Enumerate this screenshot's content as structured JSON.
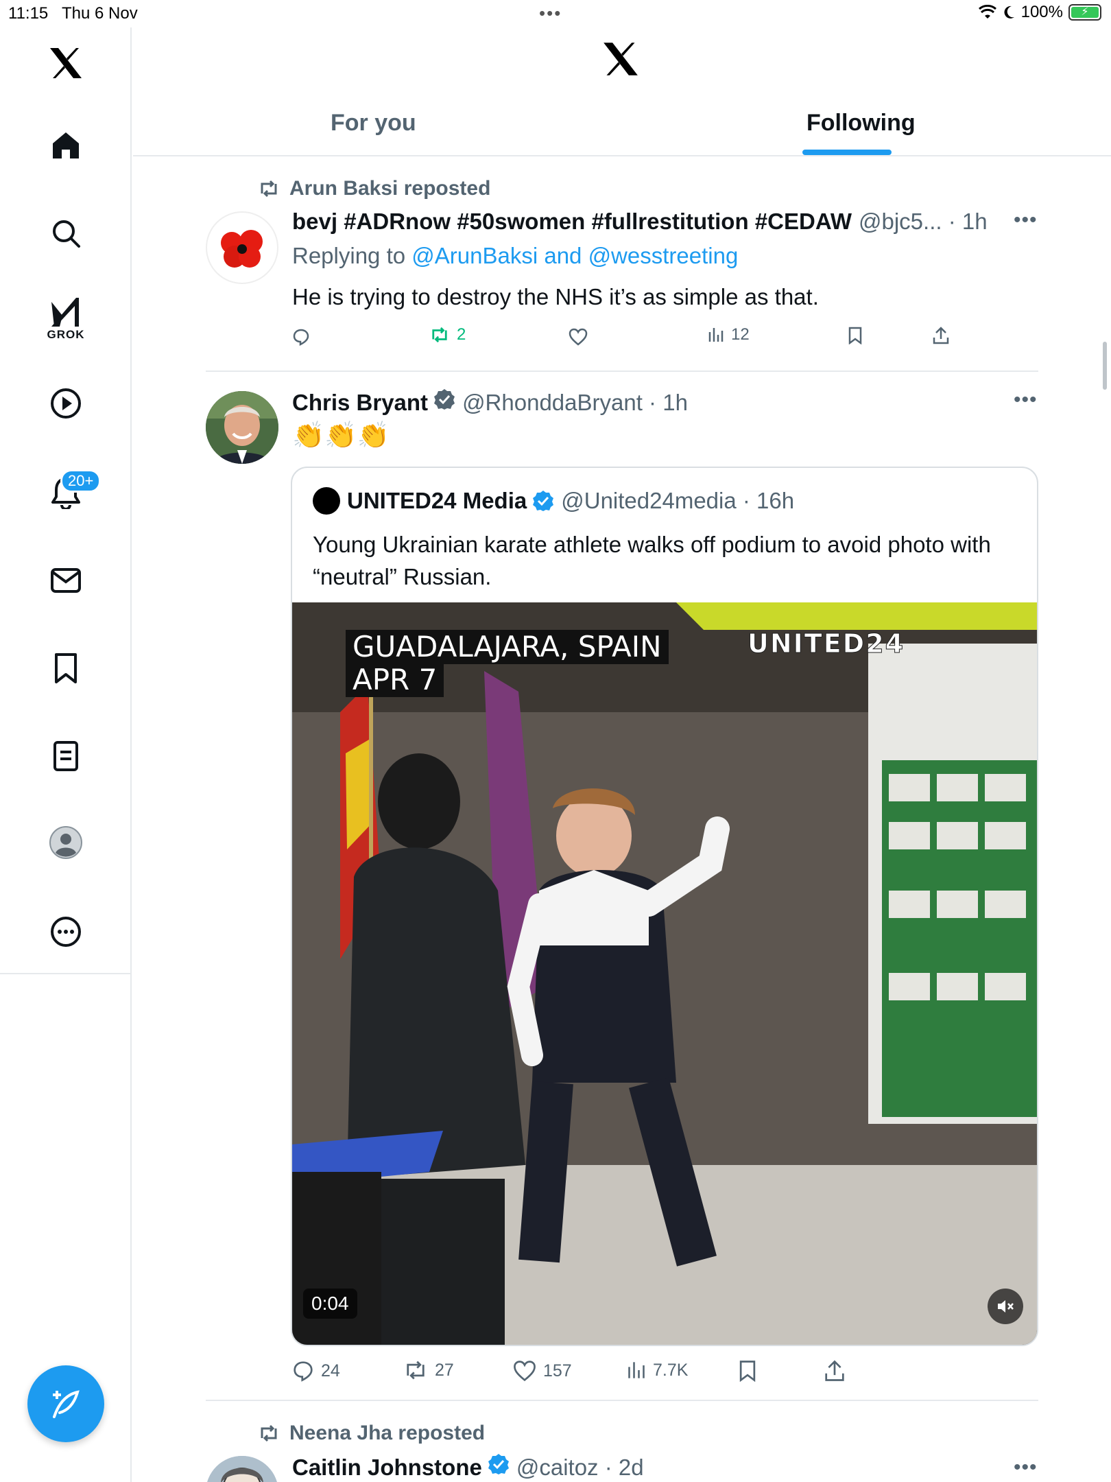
{
  "status": {
    "time": "11:15",
    "date": "Thu 6 Nov",
    "battery": "100%"
  },
  "sidebar": {
    "grok_label": "GROK",
    "notifications_badge": "20+"
  },
  "header": {
    "tabs": [
      {
        "label": "For you"
      },
      {
        "label": "Following"
      }
    ]
  },
  "tweets": [
    {
      "repost_by": "Arun Baksi reposted",
      "name": "bevj #ADRnow #50swomen #fullrestitution #CEDAW",
      "handle": "@bjc5... · 1h",
      "reply_prefix": "Replying to ",
      "reply_links": "@ArunBaksi and @wesstreeting",
      "text": "He is trying to destroy the NHS it’s as simple as that.",
      "stats": {
        "replies": "",
        "reposts": "2",
        "likes": "",
        "views": "12"
      }
    },
    {
      "name": "Chris Bryant",
      "handle": "@RhonddaBryant · 1h",
      "text": "👏👏👏",
      "quote": {
        "name": "UNITED24 Media",
        "handle": "@United24media · 16h",
        "text": "Young Ukrainian karate athlete walks off podium to avoid photo with “neutral” Russian.",
        "video_overlay_line1": "GUADALAJARA, SPAIN",
        "video_overlay_line2": "APR 7",
        "video_brand": "UNITED24",
        "duration": "0:04"
      },
      "stats": {
        "replies": "24",
        "reposts": "27",
        "likes": "157",
        "views": "7.7K"
      }
    },
    {
      "repost_by": "Neena Jha reposted",
      "name": "Caitlin Johnstone",
      "handle": "@caitoz · 2d"
    }
  ],
  "colors": {
    "accent": "#1d9bf0",
    "repost_green": "#00ba7c",
    "secondary_text": "#536471"
  }
}
